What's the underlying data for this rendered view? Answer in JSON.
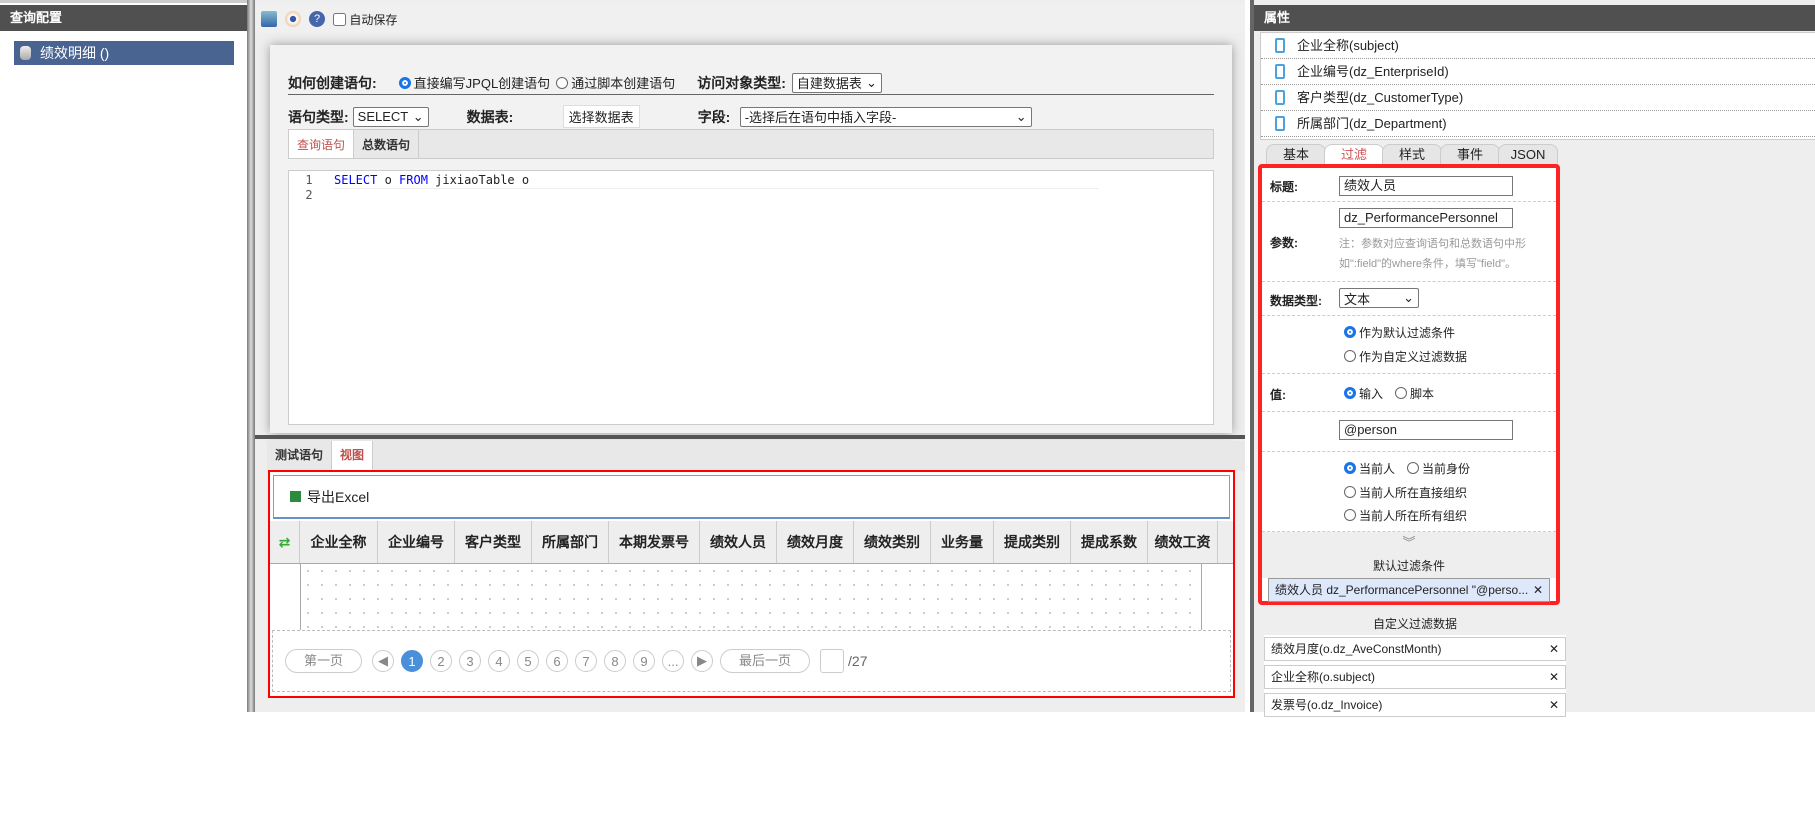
{
  "left": {
    "title": "查询配置",
    "tree_item": "绩效明细 ()"
  },
  "toolbar": {
    "autosave": "自动保存"
  },
  "form": {
    "create_label": "如何创建语句:",
    "opt_jpql": "直接编写JPQL创建语句",
    "opt_script": "通过脚本创建语句",
    "access_label": "访问对象类型:",
    "access_value": "自建数据表",
    "stmt_type_label": "语句类型:",
    "stmt_type_value": "SELECT",
    "table_label": "数据表:",
    "table_button": "选择数据表",
    "field_label": "字段:",
    "field_value": "-选择后在语句中插入字段-"
  },
  "editor": {
    "tabs": [
      "查询语句",
      "总数语句"
    ],
    "lines": [
      "1",
      "2"
    ],
    "kw1": "SELECT",
    "t1": " o ",
    "kw2": "FROM",
    "t2": " jixiaoTable o"
  },
  "bottom": {
    "tabs": [
      "测试语句",
      "视图"
    ],
    "export": "导出Excel",
    "columns": [
      "企业全称",
      "企业编号",
      "客户类型",
      "所属部门",
      "本期发票号",
      "绩效人员",
      "绩效月度",
      "绩效类别",
      "业务量",
      "提成类别",
      "提成系数",
      "绩效工资"
    ],
    "pager": {
      "first": "第一页",
      "pages": [
        "1",
        "2",
        "3",
        "4",
        "5",
        "6",
        "7",
        "8",
        "9",
        "..."
      ],
      "last": "最后一页",
      "total": "/27"
    }
  },
  "right": {
    "title": "属性",
    "fields": [
      "企业全称(subject)",
      "企业编号(dz_EnterpriseId)",
      "客户类型(dz_CustomerType)",
      "所属部门(dz_Department)"
    ],
    "tabs": [
      "基本",
      "过滤",
      "样式",
      "事件",
      "JSON"
    ],
    "filter": {
      "title_label": "标题:",
      "title_value": "绩效人员",
      "param_label": "参数:",
      "param_value": "dz_PerformancePersonnel",
      "note1": "注：参数对应查询语句和总数语句中形",
      "note2": "如\":field\"的where条件，填写\"field\"。",
      "dtype_label": "数据类型:",
      "dtype_value": "文本",
      "opt_default": "作为默认过滤条件",
      "opt_custom": "作为自定义过滤数据",
      "value_label": "值:",
      "opt_input": "输入",
      "opt_script": "脚本",
      "value": "@person",
      "opt_cur": "当前人",
      "opt_identity": "当前身份",
      "opt_direct_org": "当前人所在直接组织",
      "opt_all_org": "当前人所在所有组织",
      "default_title": "默认过滤条件",
      "default_chip": "绩效人员 dz_PerformancePersonnel \"@perso..."
    },
    "custom_title": "自定义过滤数据",
    "custom_chips": [
      "绩效月度(o.dz_AveConstMonth)",
      "企业全称(o.subject)",
      "发票号(o.dz_Invoice)"
    ]
  }
}
